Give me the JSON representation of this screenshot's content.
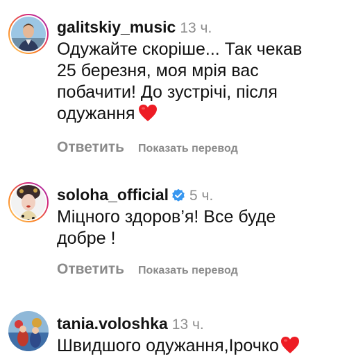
{
  "comments": [
    {
      "username": "galitskiy_music",
      "time": "13 ч.",
      "lines": [
        "Одужайте скоріше... Так чекав",
        "25 березня, моя мрія вас",
        "побачити! До зустрічі, після",
        "одужання"
      ],
      "reply": "Ответить",
      "translate": "Показать перевод",
      "avatar_icon": "profile-photo",
      "emoji": "red-heart"
    },
    {
      "username": "soloha_official",
      "time": "5 ч.",
      "verified": true,
      "lines": [
        "Міцного здоров’я! Все буде",
        "добре !"
      ],
      "reply": "Ответить",
      "translate": "Показать перевод",
      "avatar_icon": "profile-photo"
    },
    {
      "username": "tania.voloshka",
      "time": "13 ч.",
      "lines": [
        "Швидшого одужання,Ірочко"
      ],
      "avatar_icon": "profile-photo",
      "emoji": "red-heart"
    }
  ],
  "colors": {
    "text": "#111111",
    "muted": "#8e8e8e",
    "verified_blue": "#3897f0",
    "heart_red": "#ed1c24",
    "story_ring": [
      "#feda75",
      "#fa7e1e",
      "#d62976",
      "#962fbf"
    ]
  }
}
